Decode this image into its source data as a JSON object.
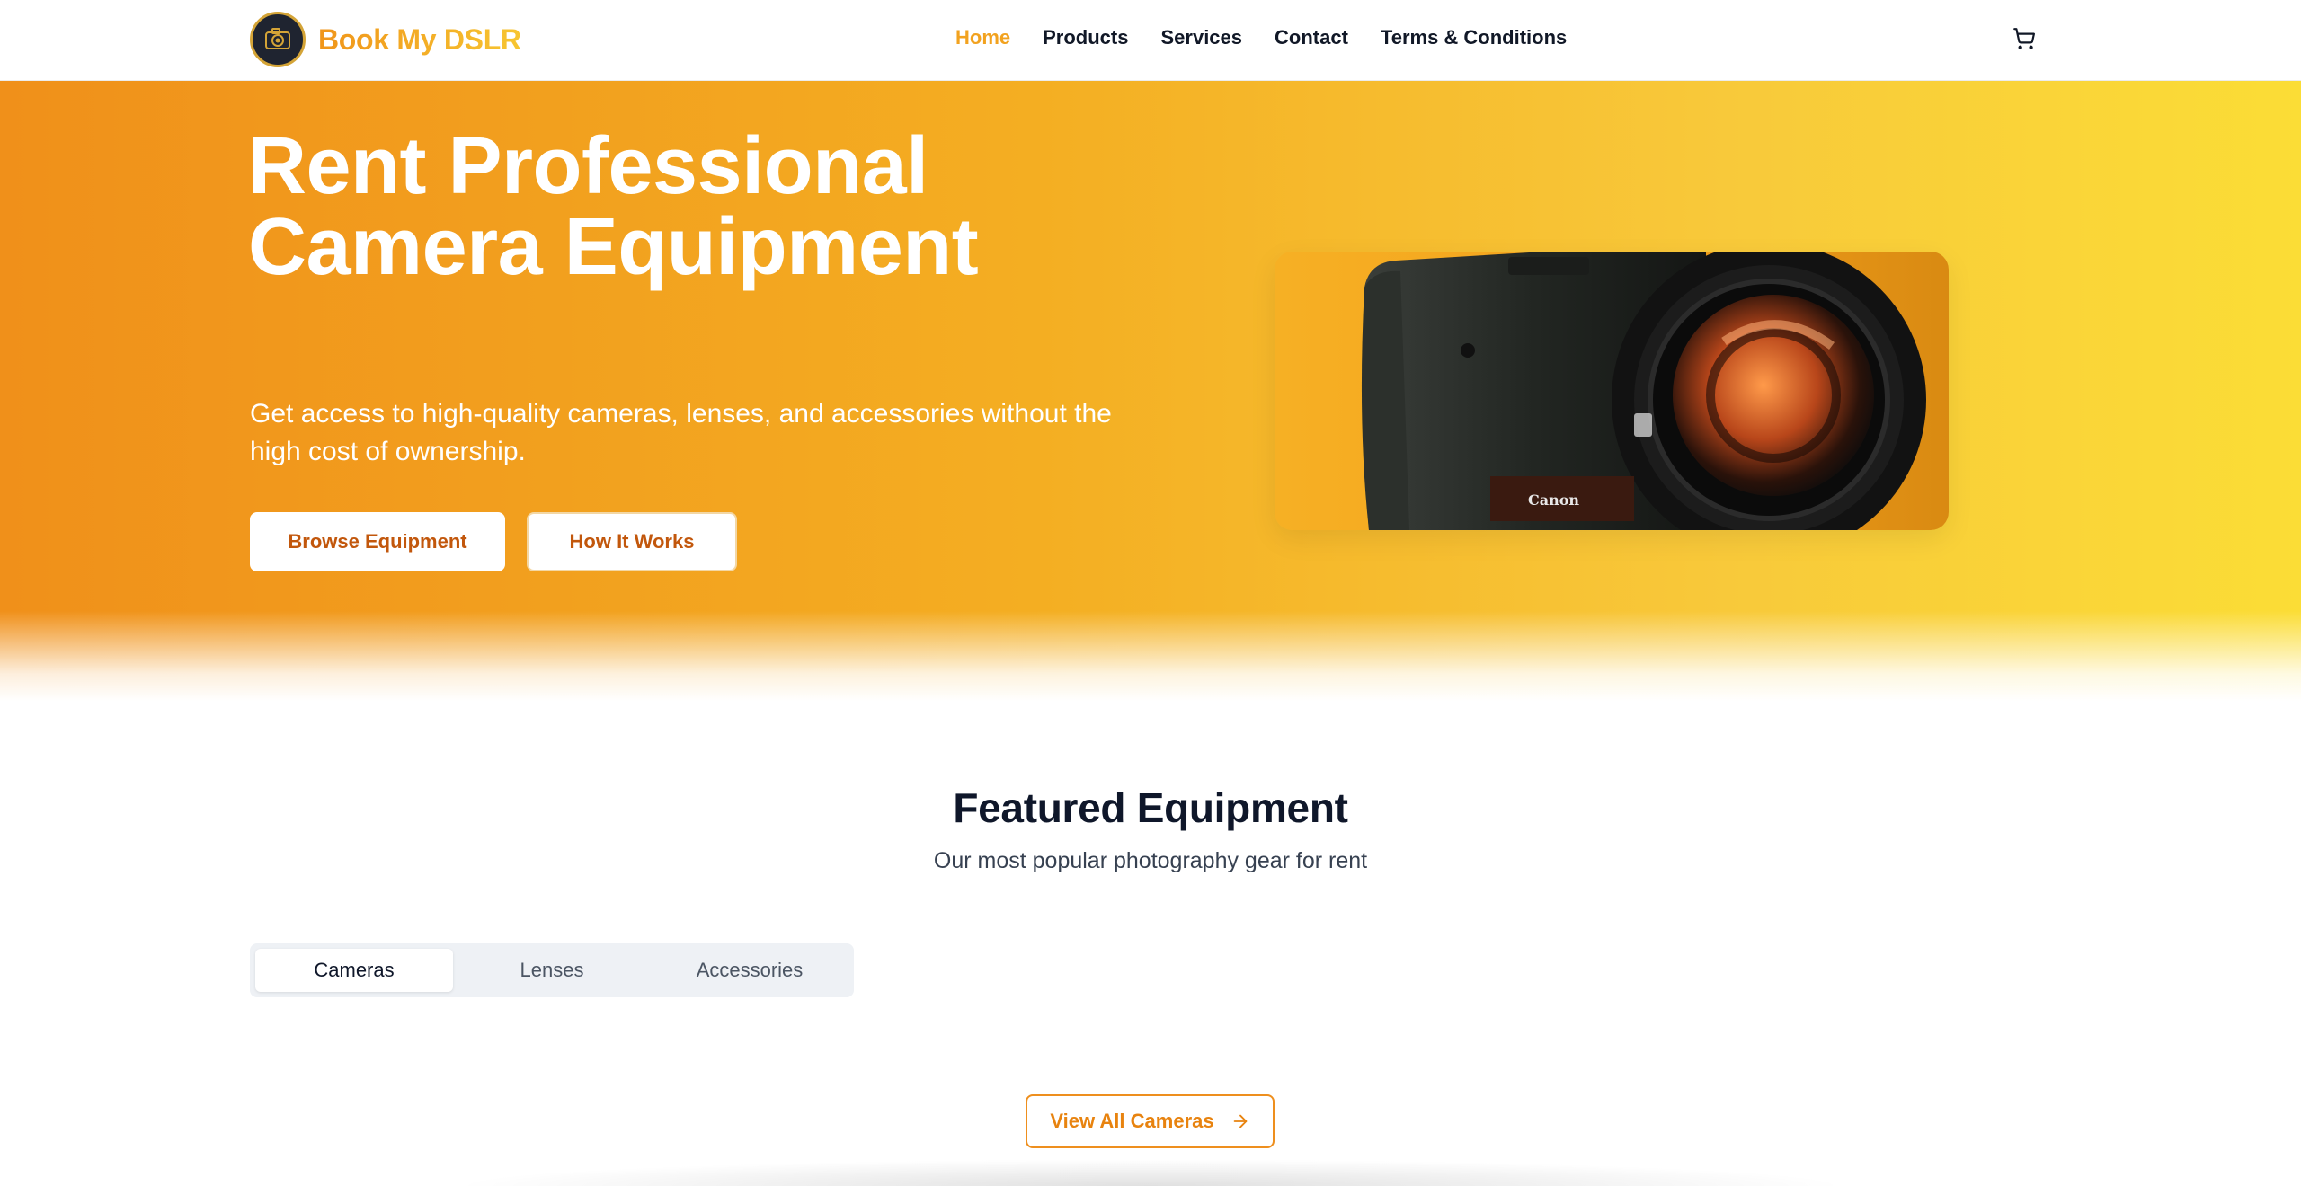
{
  "navbar": {
    "brand_name": "Book My DSLR",
    "links": [
      {
        "label": "Home",
        "active": true
      },
      {
        "label": "Products",
        "active": false
      },
      {
        "label": "Services",
        "active": false
      },
      {
        "label": "Contact",
        "active": false
      },
      {
        "label": "Terms & Conditions",
        "active": false
      }
    ],
    "cart_icon": "shopping-cart-icon",
    "logo_icon": "camera-logo-icon"
  },
  "hero": {
    "title_line1": "Rent Professional",
    "title_line2": "Camera Equipment",
    "subtitle": "Get access to high-quality cameras, lenses, and accessories without the high cost of ownership.",
    "primary_button": "Browse Equipment",
    "secondary_button": "How It Works",
    "image_brand_text": "Canon",
    "gradient_colors": [
      "#f0901a",
      "#fbdd36"
    ]
  },
  "featured": {
    "title": "Featured Equipment",
    "subtitle": "Our most popular photography gear for rent",
    "tabs": [
      {
        "label": "Cameras",
        "active": true
      },
      {
        "label": "Lenses",
        "active": false
      },
      {
        "label": "Accessories",
        "active": false
      }
    ],
    "view_all_label": "View All Cameras",
    "view_all_icon": "arrow-right-icon"
  },
  "colors": {
    "accent": "#f2a21f",
    "button_text": "#c2570c",
    "outline_button": "#e8830f"
  }
}
